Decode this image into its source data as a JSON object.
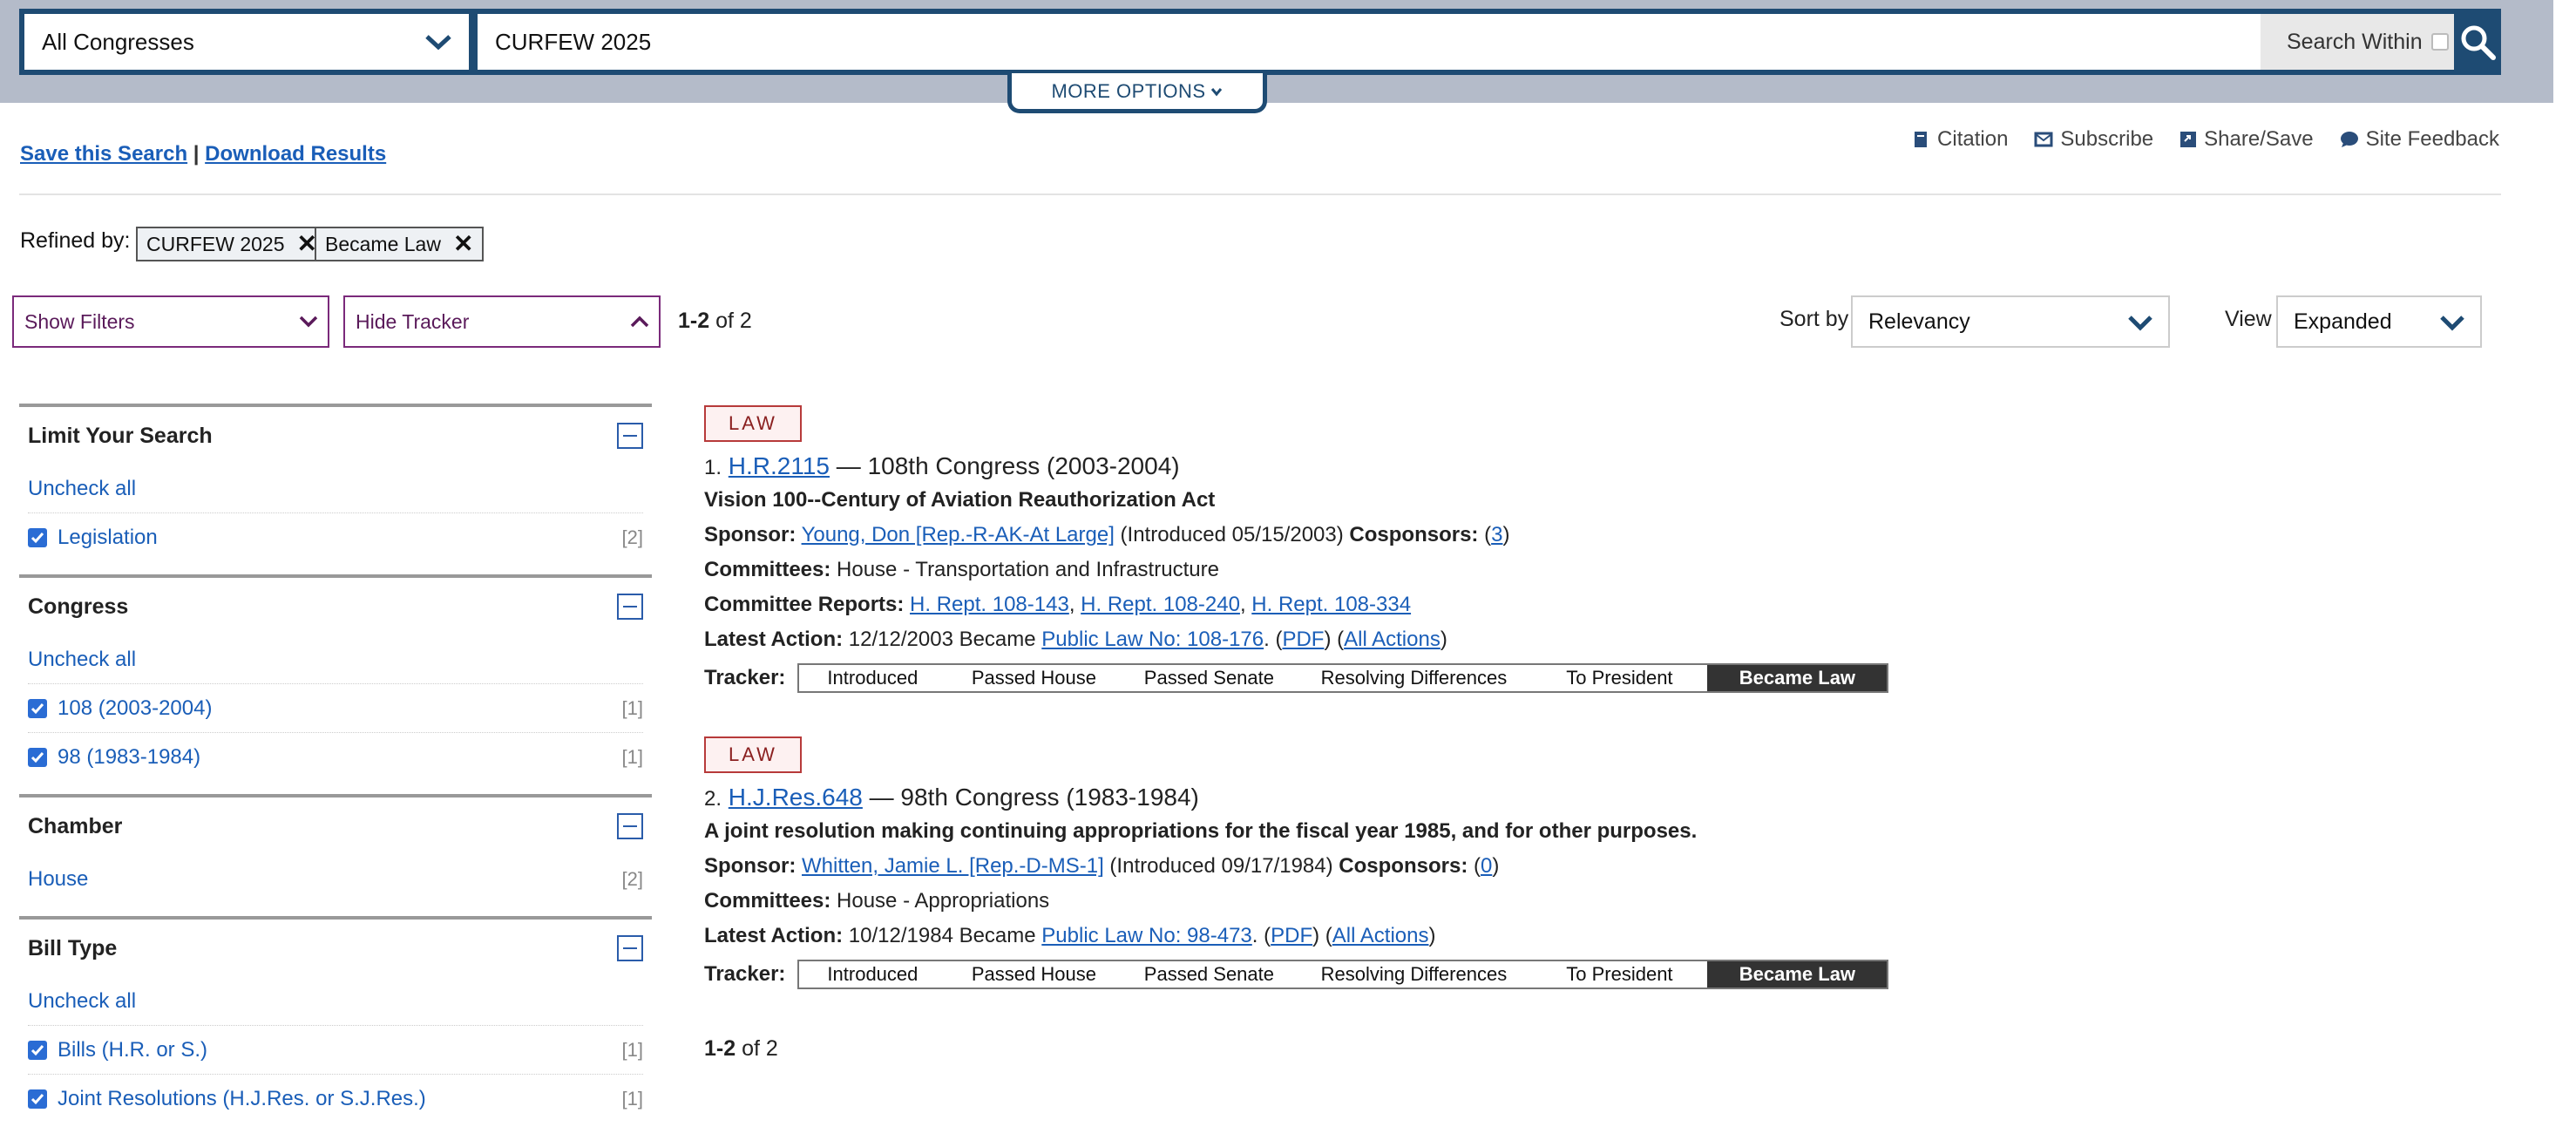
{
  "search": {
    "congress_selected": "All Congresses",
    "query": "CURFEW 2025",
    "search_within_label": "Search Within",
    "more_options": "MORE OPTIONS"
  },
  "links": {
    "save_search": "Save this Search",
    "separator": "|",
    "download_results": "Download Results"
  },
  "tools": [
    {
      "label": "Citation",
      "icon": "citation-icon"
    },
    {
      "label": "Subscribe",
      "icon": "mail-icon"
    },
    {
      "label": "Share/Save",
      "icon": "share-icon"
    },
    {
      "label": "Site Feedback",
      "icon": "comment-icon"
    }
  ],
  "refined": {
    "label": "Refined by:",
    "chips": [
      "CURFEW 2025",
      "Became Law"
    ]
  },
  "controls": {
    "show_filters": "Show Filters",
    "hide_tracker": "Hide Tracker",
    "count_bold": "1-2",
    "count_rest": " of 2",
    "sort_label": "Sort by",
    "sort_value": "Relevancy",
    "view_label": "View",
    "view_value": "Expanded"
  },
  "filters": [
    {
      "title": "Limit Your Search",
      "uncheck": "Uncheck all",
      "items": [
        {
          "label": "Legislation",
          "count": "[2]",
          "checked": true
        }
      ]
    },
    {
      "title": "Congress",
      "uncheck": "Uncheck all",
      "items": [
        {
          "label": "108 (2003-2004)",
          "count": "[1]",
          "checked": true
        },
        {
          "label": "98 (1983-1984)",
          "count": "[1]",
          "checked": true
        }
      ]
    },
    {
      "title": "Chamber",
      "uncheck": "",
      "items": [
        {
          "label": "House",
          "count": "[2]",
          "checked": false
        }
      ]
    },
    {
      "title": "Bill Type",
      "uncheck": "Uncheck all",
      "items": [
        {
          "label": "Bills (H.R. or S.)",
          "count": "[1]",
          "checked": true
        },
        {
          "label": "Joint Resolutions (H.J.Res. or S.J.Res.)",
          "count": "[1]",
          "checked": true
        }
      ]
    }
  ],
  "results": [
    {
      "badge": "LAW",
      "number": "1.",
      "bill": "H.R.2115",
      "congress": " — 108th Congress (2003-2004)",
      "title": "Vision 100--Century of Aviation Reauthorization Act",
      "sponsor_label": "Sponsor:",
      "sponsor": "Young, Don [Rep.-R-AK-At Large]",
      "introduced": " (Introduced 05/15/2003) ",
      "cosponsors_label": "Cosponsors:",
      "cosponsors": "3",
      "committees_label": "Committees:",
      "committees": " House - Transportation and Infrastructure",
      "reports_label": "Committee Reports:",
      "reports": [
        "H. Rept. 108-143",
        "H. Rept. 108-240",
        "H. Rept. 108-334"
      ],
      "action_label": "Latest Action:",
      "action_text": " 12/12/2003 Became ",
      "public_law": "Public Law No: 108-176",
      "pdf": "PDF",
      "all_actions": "All Actions"
    },
    {
      "badge": "LAW",
      "number": "2.",
      "bill": "H.J.Res.648",
      "congress": " — 98th Congress (1983-1984)",
      "title": "A joint resolution making continuing appropriations for the fiscal year 1985, and for other purposes.",
      "sponsor_label": "Sponsor:",
      "sponsor": "Whitten, Jamie L. [Rep.-D-MS-1]",
      "introduced": " (Introduced 09/17/1984) ",
      "cosponsors_label": "Cosponsors:",
      "cosponsors": "0",
      "committees_label": "Committees:",
      "committees": " House - Appropriations",
      "action_label": "Latest Action:",
      "action_text": " 10/12/1984 Became ",
      "public_law": "Public Law No: 98-473",
      "pdf": "PDF",
      "all_actions": "All Actions"
    }
  ],
  "tracker": {
    "label": "Tracker:",
    "steps": [
      "Introduced",
      "Passed House",
      "Passed Senate",
      "Resolving Differences",
      "To President",
      "Became Law"
    ],
    "active_index": 5
  },
  "colors": {
    "searchbar": "#1e4b73",
    "link": "#1a5eb8",
    "filter_border": "#7b2a7b",
    "badge": "#b73a3a"
  }
}
